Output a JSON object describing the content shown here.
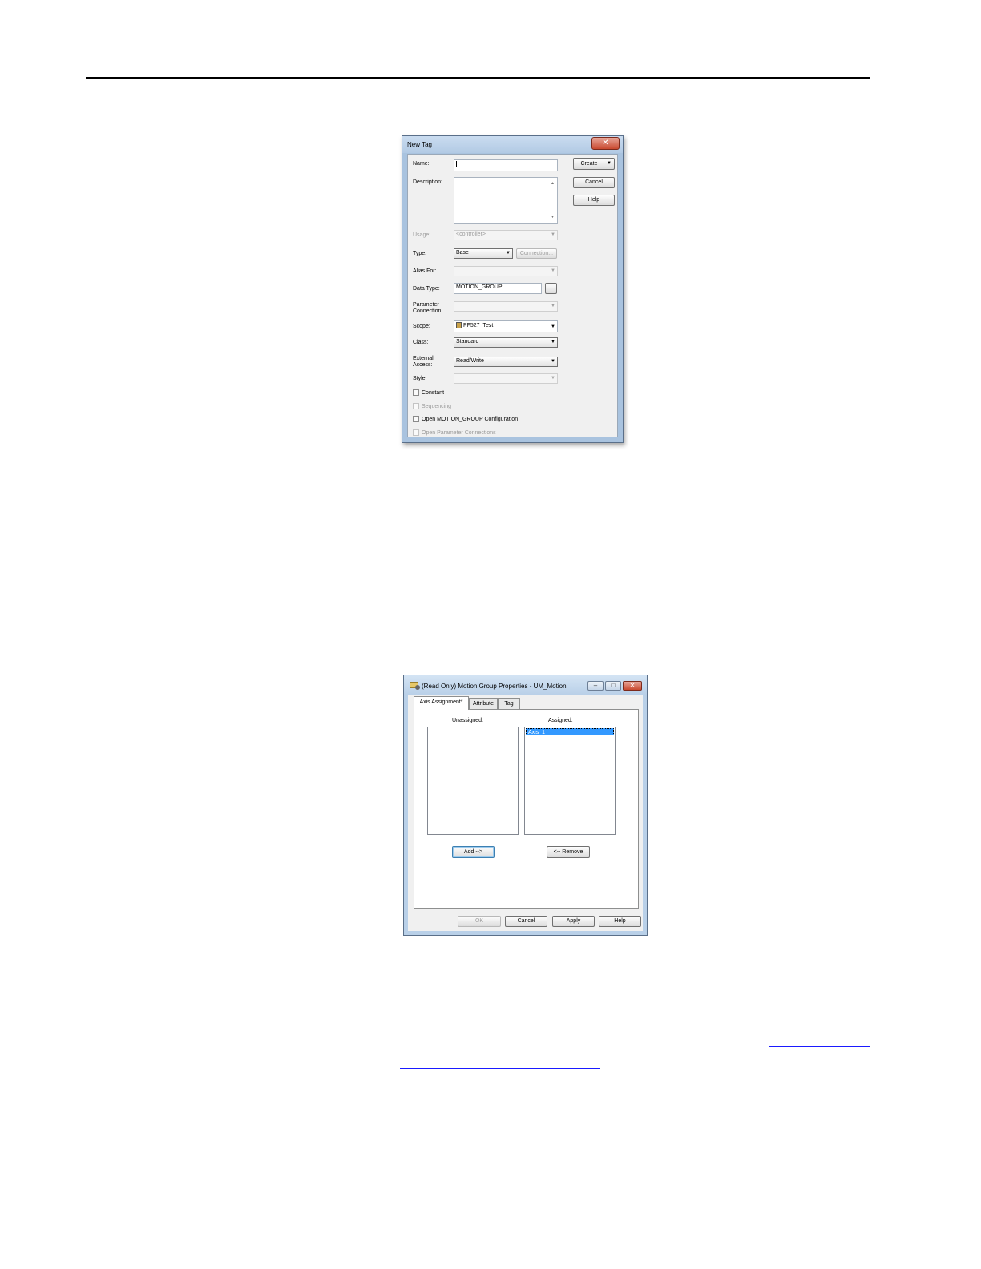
{
  "new_tag_dialog": {
    "title": "New Tag",
    "close_glyph": "✕",
    "labels": {
      "name": "Name:",
      "description": "Description:",
      "usage": "Usage:",
      "type": "Type:",
      "alias_for": "Alias For:",
      "data_type": "Data Type:",
      "parameter_connection_1": "Parameter",
      "parameter_connection_2": "Connection:",
      "scope": "Scope:",
      "class": "Class:",
      "external_access_1": "External",
      "external_access_2": "Access:",
      "style": "Style:"
    },
    "fields": {
      "name_value": "",
      "usage_value": "<controller>",
      "type_value": "Base",
      "alias_for_value": "",
      "data_type_value": "MOTION_GROUP",
      "parameter_connection_value": "",
      "scope_value": "PF527_Test",
      "class_value": "Standard",
      "external_access_value": "Read/Write",
      "style_value": ""
    },
    "buttons": {
      "create": "Create",
      "cancel": "Cancel",
      "help": "Help",
      "connection": "Connection...",
      "browse": "..."
    },
    "checkboxes": {
      "constant": "Constant",
      "sequencing": "Sequencing",
      "open_config": "Open MOTION_GROUP Configuration",
      "open_param": "Open Parameter Connections"
    },
    "arrow_glyph": "▼",
    "scroll_up": "▲",
    "scroll_down": "▼"
  },
  "motion_group_dialog": {
    "title": "(Read Only) Motion Group Properties - UM_Motion",
    "tabs": [
      "Axis Assignment*",
      "Attribute",
      "Tag"
    ],
    "unassigned_label": "Unassigned:",
    "assigned_label": "Assigned:",
    "assigned_items": [
      "Axis_1"
    ],
    "add_button": "Add -->",
    "remove_button": "<-- Remove",
    "footer_buttons": {
      "ok": "OK",
      "cancel": "Cancel",
      "apply": "Apply",
      "help": "Help"
    },
    "window_buttons": {
      "minimize": "–",
      "maximize": "□",
      "close": "✕"
    }
  }
}
